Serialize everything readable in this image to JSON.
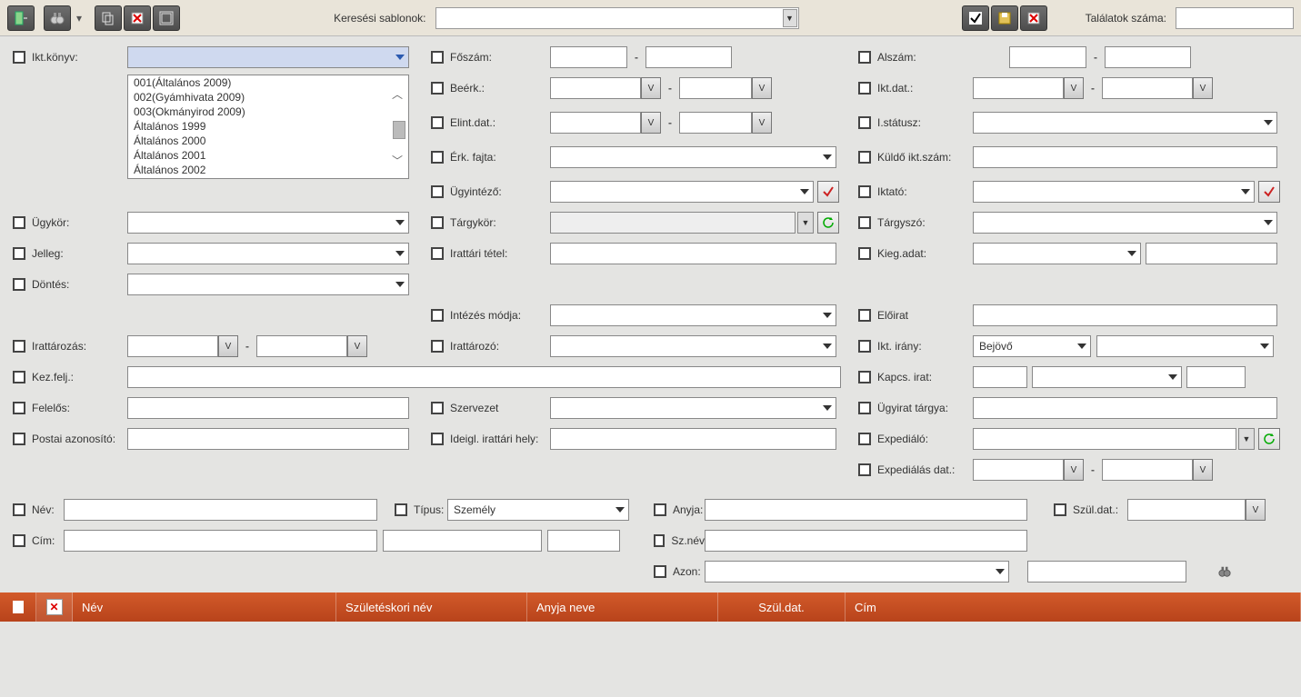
{
  "toolbar": {
    "search_templates_label": "Keresési sablonok:",
    "hits_label": "Találatok száma:"
  },
  "labels": {
    "ikt_konyv": "Ikt.könyv:",
    "foszam": "Főszám:",
    "alszam": "Alszám:",
    "beerk": "Beérk.:",
    "ikt_dat": "Ikt.dat.:",
    "elint_dat": "Elint.dat.:",
    "i_status": "I.státusz:",
    "erk_fajta": "Érk. fajta:",
    "kuldo_ikt": "Küldő ikt.szám:",
    "ugyintezo": "Ügyintéző:",
    "iktato": "Iktató:",
    "ugykor": "Ügykör:",
    "targykor": "Tárgykör:",
    "targyszo": "Tárgyszó:",
    "jelleg": "Jelleg:",
    "irattari_tetel": "Irattári tétel:",
    "kieg_adat": "Kieg.adat:",
    "dontes": "Döntés:",
    "intezes_modja": "Intézés módja:",
    "eloirat": "Előirat",
    "irattarozas": "Irattározás:",
    "irattarozo": "Irattározó:",
    "ikt_irany": "Ikt. irány:",
    "kez_felj": "Kez.felj.:",
    "kapcs_irat": "Kapcs. irat:",
    "felelos": "Felelős:",
    "szervezet": "Szervezet",
    "ugyirat_targya": "Ügyirat tárgya:",
    "postai_azon": "Postai azonosító:",
    "ideigl_irattari_hely": "Ideigl. irattári hely:",
    "expedialo": "Expediáló:",
    "expedialas_dat": "Expediálás dat.:",
    "nev": "Név:",
    "tipus": "Típus:",
    "anyja": "Anyja:",
    "szul_dat": "Szül.dat.:",
    "cim": "Cím:",
    "sz_nev": "Sz.név",
    "azon": "Azon:"
  },
  "values": {
    "ikt_irany_selected": "Bejövő",
    "tipus_selected": "Személy"
  },
  "listbox_items": [
    "001(Általános 2009)",
    "002(Gyámhivata 2009)",
    "003(Okmányirod 2009)",
    "Általános 1999",
    "Általános 2000",
    "Általános 2001",
    "Általános 2002"
  ],
  "results_header": {
    "nev": "Név",
    "szul_nev": "Születéskori név",
    "anyja_neve": "Anyja neve",
    "szul_dat": "Szül.dat.",
    "cim": "Cím"
  }
}
